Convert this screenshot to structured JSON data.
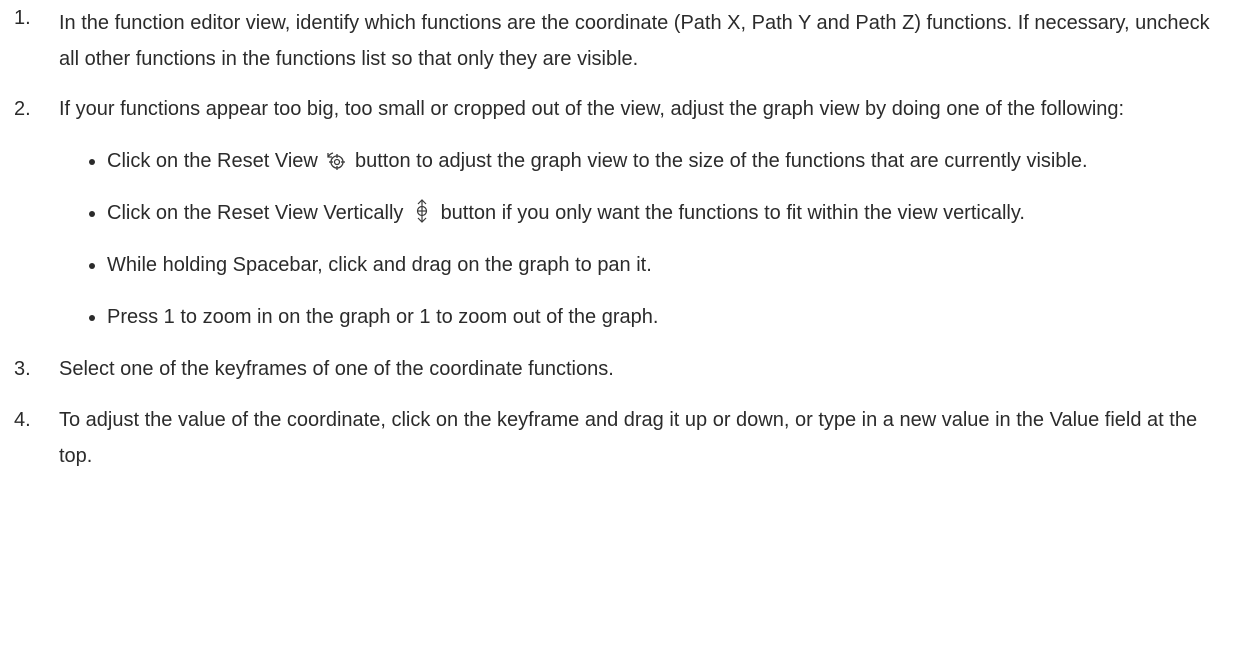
{
  "steps": [
    {
      "number": "1.",
      "text": "In the function editor view, identify which functions are the coordinate (Path X, Path Y and Path Z) functions. If necessary, uncheck all other functions in the functions list so that only they are visible."
    },
    {
      "number": "2.",
      "text": "If your functions appear too big, too small or cropped out of the view, adjust the graph view by doing one of the following:",
      "options": [
        {
          "before": "Click on the Reset View",
          "icon": "reset-view-icon",
          "after": "button to adjust the graph view to the size of the functions that are currently visible."
        },
        {
          "before": "Click on the Reset View Vertically",
          "icon": "reset-view-vertically-icon",
          "after": "button if you only want the functions to fit within the view vertically."
        },
        {
          "text": "While holding Spacebar, click and drag on the graph to pan it."
        },
        {
          "text": "Press 1 to zoom in on the graph or 1 to zoom out of the graph."
        }
      ]
    },
    {
      "number": "3.",
      "text": "Select one of the keyframes of one of the coordinate functions."
    },
    {
      "number": "4.",
      "text": "To adjust the value of the coordinate, click on the keyframe and drag it up or down, or type in a new value in the Value field at the top."
    }
  ]
}
